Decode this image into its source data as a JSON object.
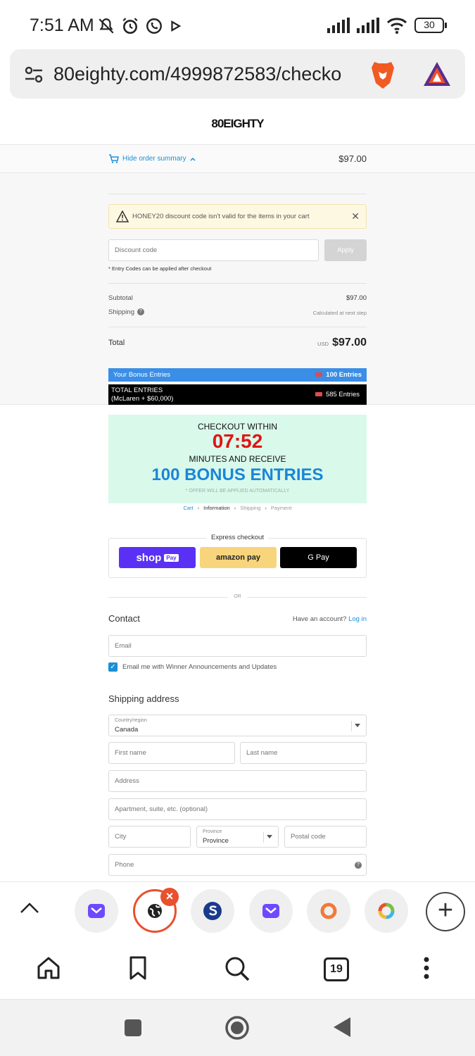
{
  "status_bar": {
    "time": "7:51 AM",
    "battery": "30"
  },
  "browser": {
    "url": "80eighty.com/4999872583/checko",
    "tab_count": "19"
  },
  "site": {
    "logo": "80EIGHTY"
  },
  "summary": {
    "toggle_label": "Hide order summary",
    "total": "$97.00",
    "alert_text": "HONEY20 discount code isn't valid for the items in your cart",
    "discount_placeholder": "Discount code",
    "apply_label": "Apply",
    "entry_note": "* Entry Codes can be applied after checkout",
    "subtotal_label": "Subtotal",
    "subtotal_value": "$97.00",
    "shipping_label": "Shipping",
    "shipping_value": "Calculated at next step",
    "total_label": "Total",
    "currency": "USD",
    "total_value": "$97.00",
    "bonus_label": "Your Bonus Entries",
    "bonus_value": "100 Entries",
    "total_entries_label": "TOTAL ENTRIES",
    "total_entries_sub": "(McLaren + $60,000)",
    "total_entries_value": "585 Entries"
  },
  "promo": {
    "line1": "CHECKOUT WITHIN",
    "timer": "07:52",
    "line2": "MINUTES AND RECEIVE",
    "headline": "100 BONUS ENTRIES",
    "note": "* OFFER WILL BE APPLIED AUTOMATICALLY"
  },
  "breadcrumb": [
    "Cart",
    "Information",
    "Shipping",
    "Payment"
  ],
  "express": {
    "title": "Express checkout",
    "shop_pay": "shop",
    "shop_pay_badge": "Pay",
    "amazon_pay": "amazon pay",
    "google_pay": "G Pay",
    "or": "OR"
  },
  "contact": {
    "heading": "Contact",
    "have_account": "Have an account?",
    "login": "Log in",
    "email_placeholder": "Email",
    "newsletter_label": "Email me with Winner Announcements and Updates",
    "newsletter_checked": true
  },
  "shipping": {
    "heading": "Shipping address",
    "country_label": "Country/region",
    "country_value": "Canada",
    "first_name": "First name",
    "last_name": "Last name",
    "address": "Address",
    "apartment": "Apartment, suite, etc. (optional)",
    "city": "City",
    "province_label": "Province",
    "province_value": "Province",
    "postal": "Postal code",
    "phone": "Phone"
  },
  "colors": {
    "accent": "#1a8fd6",
    "timer": "#e01515",
    "promo_bg": "#d9f9ea",
    "shop_pay": "#5a31f4",
    "amazon_pay": "#f8d57c",
    "active_tab": "#e8512d"
  }
}
